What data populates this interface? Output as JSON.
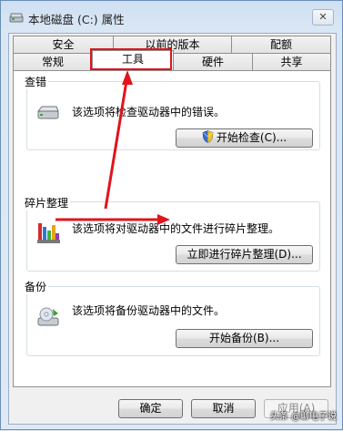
{
  "window": {
    "title": "本地磁盘 (C:) 属性",
    "close_label": "✕"
  },
  "tabs": {
    "row_top": [
      {
        "label": "安全"
      },
      {
        "label": "以前的版本"
      },
      {
        "label": "配额"
      }
    ],
    "row_bottom": [
      {
        "label": "常规"
      },
      {
        "label": "工具",
        "selected": true
      },
      {
        "label": "硬件"
      },
      {
        "label": "共享"
      }
    ]
  },
  "sections": {
    "error_check": {
      "title": "查错",
      "description": "该选项将检查驱动器中的错误。",
      "button": "开始检查(C)...",
      "icon": "hard-drive-icon"
    },
    "defrag": {
      "title": "碎片整理",
      "description": "该选项将对驱动器中的文件进行碎片整理。",
      "button": "立即进行碎片整理(D)...",
      "icon": "defrag-icon"
    },
    "backup": {
      "title": "备份",
      "description": "该选项将备份驱动器中的文件。",
      "button": "开始备份(B)...",
      "icon": "backup-icon"
    }
  },
  "footer": {
    "ok": "确定",
    "cancel": "取消",
    "apply": "应用(A)"
  },
  "annotation_color": "#e0141c",
  "watermark": "头条 @聊电子说"
}
